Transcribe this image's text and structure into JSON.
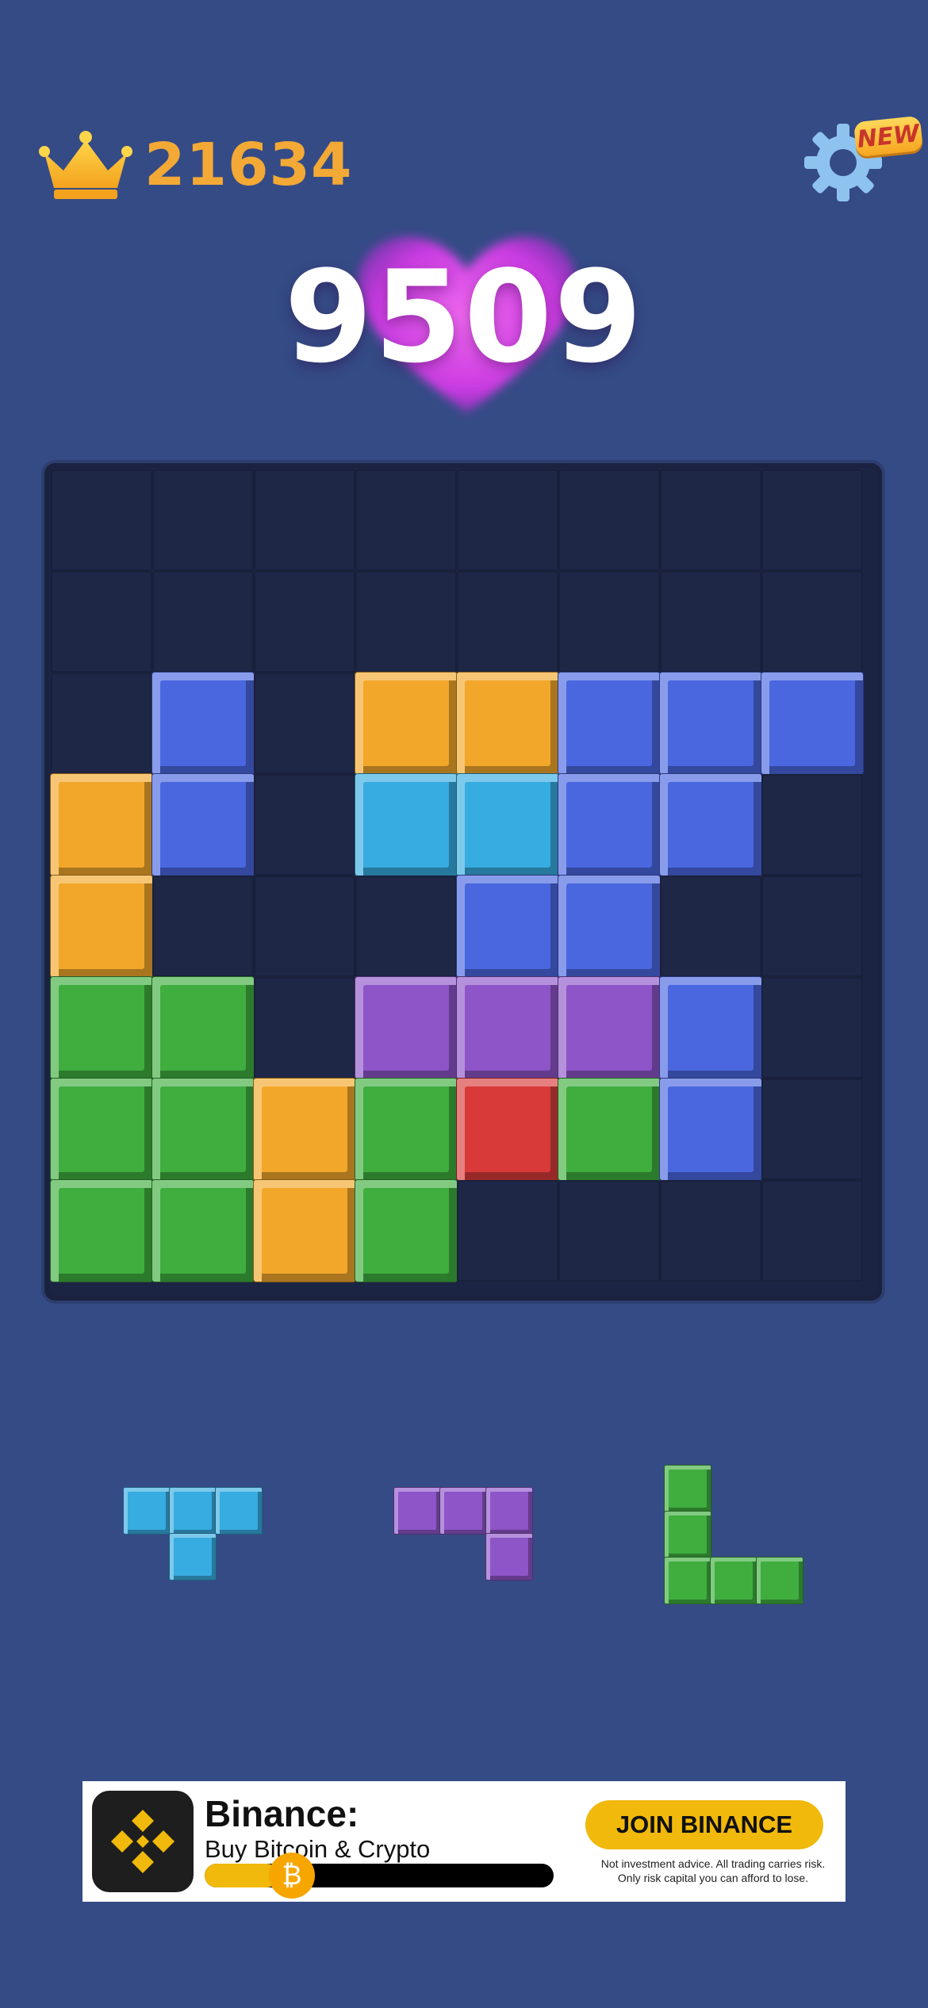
{
  "header": {
    "best_score": "21634",
    "crown_icon": "crown-icon",
    "settings_icon": "gear-icon",
    "new_badge": "NEW"
  },
  "score": {
    "value": "9509",
    "heart_icon": "heart-icon"
  },
  "board": {
    "size": 8,
    "colors": {
      "Y": "#f2a72b",
      "B": "#4a67e0",
      "C": "#37ace0",
      "G": "#3fae3f",
      "P": "#8d55c8",
      "R": "#d83a3a"
    },
    "rows": [
      "........",
      "........",
      ".B.YYBBB",
      "YB.CCBB.",
      "Y...BB..",
      "GG.PPPB.",
      "GGYGRGB.",
      "GGYG...."
    ]
  },
  "pieces": [
    {
      "color": "C",
      "cells": [
        [
          0,
          0
        ],
        [
          0,
          1
        ],
        [
          0,
          2
        ],
        [
          1,
          1
        ]
      ]
    },
    {
      "color": "P",
      "cells": [
        [
          0,
          0
        ],
        [
          0,
          1
        ],
        [
          0,
          2
        ],
        [
          1,
          2
        ]
      ]
    },
    {
      "color": "G",
      "cells": [
        [
          0,
          0
        ],
        [
          1,
          0
        ],
        [
          2,
          0
        ],
        [
          2,
          1
        ],
        [
          2,
          2
        ]
      ]
    }
  ],
  "ad": {
    "logo_icon": "binance-logo-icon",
    "title": "Binance:",
    "subtitle": "Buy Bitcoin & Crypto",
    "progress": 0.12,
    "coin_symbol": "₿",
    "button": "JOIN BINANCE",
    "disclaimer_line1": "Not investment advice. All trading carries risk.",
    "disclaimer_line2": "Only risk capital you can afford to lose."
  }
}
